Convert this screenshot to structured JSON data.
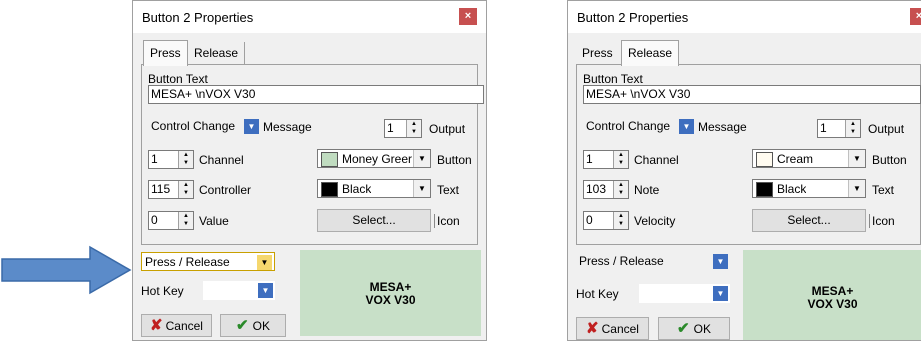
{
  "left_dialog": {
    "title": "Button 2 Properties",
    "close_label": "×",
    "tabs": [
      {
        "label": "Press"
      },
      {
        "label": "Release"
      }
    ],
    "button_text_label": "Button Text",
    "button_text_value": "MESA+ \\nVOX V30",
    "msg_type": "Control Change",
    "msg_label": "Message",
    "output_value": "1",
    "output_label": "Output",
    "channel_value": "1",
    "channel_label": "Channel",
    "button_color": "Money Greer",
    "button_color_hex": "#c0dcc0",
    "button_label": "Button",
    "param2_value": "115",
    "param2_label": "Controller",
    "text_color": "Black",
    "text_color_hex": "#000000",
    "text_label": "Text",
    "param3_value": "0",
    "param3_label": "Value",
    "select_label": "Select...",
    "icon_label": "Icon",
    "mode": "Press / Release",
    "hotkey_label": "Hot Key",
    "hotkey_value": "",
    "cancel_label": "Cancel",
    "ok_label": "OK",
    "preview_line1": "MESA+",
    "preview_line2": "VOX V30"
  },
  "right_dialog": {
    "title": "Button 2 Properties",
    "close_label": "×",
    "tabs": [
      {
        "label": "Press"
      },
      {
        "label": "Release"
      }
    ],
    "button_text_label": "Button Text",
    "button_text_value": "MESA+ \\nVOX V30",
    "msg_type": "Control Change",
    "msg_label": "Message",
    "output_value": "1",
    "output_label": "Output",
    "channel_value": "1",
    "channel_label": "Channel",
    "button_color": "Cream",
    "button_color_hex": "#fffbf0",
    "button_label": "Button",
    "param2_value": "103",
    "param2_label": "Note",
    "text_color": "Black",
    "text_color_hex": "#000000",
    "text_label": "Text",
    "param3_value": "0",
    "param3_label": "Velocity",
    "select_label": "Select...",
    "icon_label": "Icon",
    "mode": "Press / Release",
    "hotkey_label": "Hot Key",
    "hotkey_value": "",
    "cancel_label": "Cancel",
    "ok_label": "OK",
    "preview_line1": "MESA+",
    "preview_line2": "VOX V30"
  },
  "annotation": {
    "arrow_color": "#5b8bc9",
    "arrow_icon": "right-arrow-icon"
  }
}
